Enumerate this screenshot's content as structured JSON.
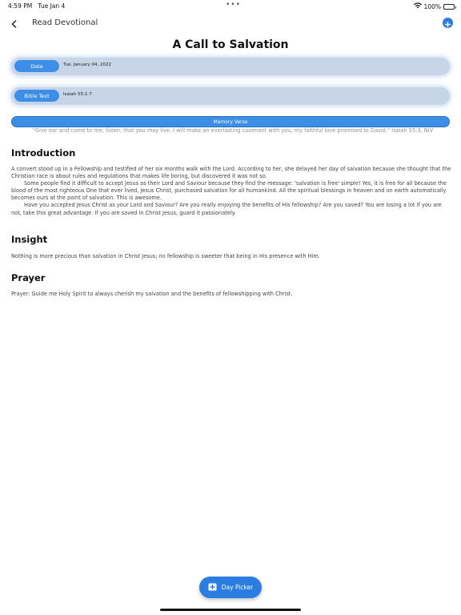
{
  "status_bar": {
    "time": "4:59 PM",
    "date": "Tue Jan 4",
    "battery": "100%"
  },
  "nav": {
    "title": "Read Devotional",
    "back_icon": "chevron-left-icon",
    "add_icon": "plus-circle-icon"
  },
  "devotional": {
    "title": "A Call to Salvation",
    "date_label": "Date",
    "date_value": "Tue, January 04, 2022",
    "bible_label": "Bible Text",
    "bible_value": "Isaiah 55:1-7",
    "memory_label": "Memory Verse",
    "memory_text": "\"Give ear and come to me; listen, that you may live. I will make an everlasting covenant with you, my faithful love promised to David.\" Isaiah 55:3, NIV"
  },
  "sections": {
    "introduction": {
      "heading": "Introduction",
      "p1": "A convert stood up in a Fellowship and testified of her six months walk with the Lord. According to her, she delayed her day of salvation because she thought that the Christian race is about  rules and regulations that makes life boring, but discovered it was not so.",
      "p2": "Some people find it difficult to accept Jesus as their Lord and Saviour because they find the message: 'salvation is free' simple! Yes, it is free for all because the blood of the most righteous One that ever lived, Jesus Christ, purchased salvation for all humankind. All the spiritual blessings in heaven and on earth automatically becomes ours at the point of salvation. This is awesome.",
      "p3": "Have you accepted Jesus Christ as your Lord and Saviour? Are you really enjoying the benefits of His fellowship? Are you saved? You are losing a lot if you are not, take this great advantage. If you are saved in Christ Jesus, guard it passionately."
    },
    "insight": {
      "heading": "Insight",
      "body": "Nothing is more precious than salvation in Christ Jesus; no fellowship is sweeter that being in His presence with Him."
    },
    "prayer": {
      "heading": "Prayer",
      "body": "Prayer: Guide me Holy Spirit to always cherish my salvation and the benefits of fellowshipping with Christ."
    }
  },
  "day_picker": {
    "label": "Day Picker",
    "icon": "calendar-plus-icon"
  },
  "colors": {
    "accent": "#2a7de1",
    "pill": "#3d8ee6",
    "row_bg": "#c6d6e8"
  }
}
